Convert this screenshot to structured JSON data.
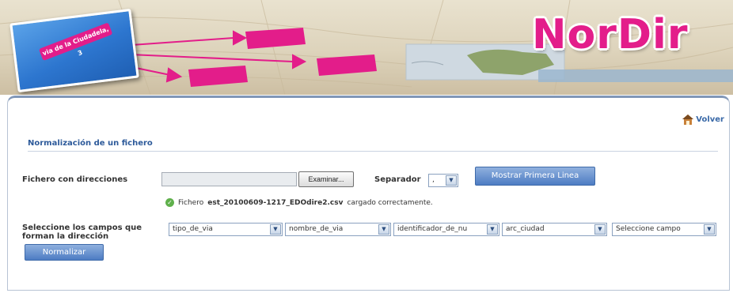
{
  "banner": {
    "logo_text": "NorDir",
    "card_label": "via de la Ciudadela, 3",
    "accent_color": "#e31d8a"
  },
  "page": {
    "back_label": "Volver",
    "section_title": "Normalización de un fichero"
  },
  "upload": {
    "file_label": "Fichero con direcciones",
    "file_value": "",
    "browse_label": "Examinar...",
    "separator_label": "Separador",
    "separator_value": ",",
    "show_first_line_label": "Mostrar Primera Linea"
  },
  "status": {
    "prefix": "Fichero",
    "filename": "est_20100609-1217_EDOdire2.csv",
    "suffix": "cargado correctamente."
  },
  "fields": {
    "label_line1": "Seleccione los campos que",
    "label_line2": "forman la dirección",
    "selects": [
      {
        "value": "tipo_de_via"
      },
      {
        "value": "nombre_de_via"
      },
      {
        "value": "identificador_de_nu"
      },
      {
        "value": "arc_ciudad"
      },
      {
        "value": "Seleccione campo"
      }
    ],
    "normalize_label": "Normalizar"
  },
  "icons": {
    "back": "home-icon",
    "status": "check-circle-icon",
    "dropdown": "chevron-down-icon"
  }
}
